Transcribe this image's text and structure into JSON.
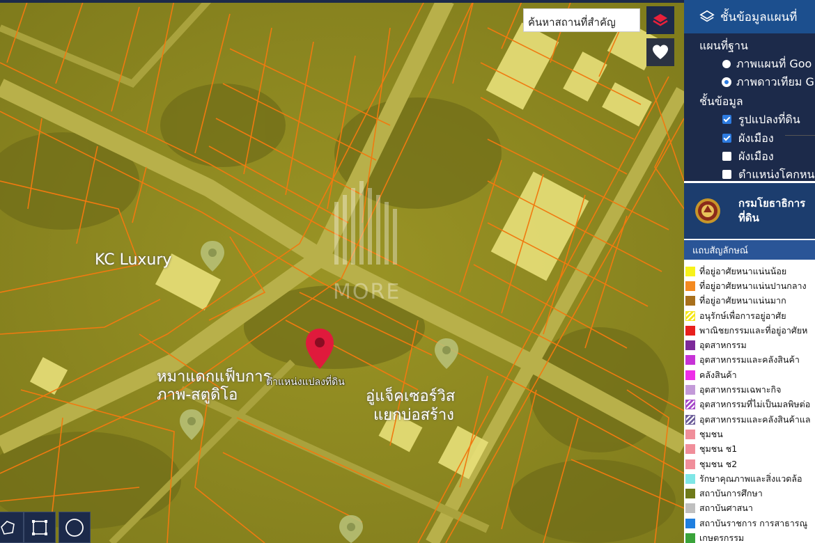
{
  "search": {
    "placeholder": "ค้นหาสถานที่สำคัญ"
  },
  "map": {
    "place_labels": [
      "KC Luxury",
      "หมาแดกแฟ็บการ",
      "ภาพ-สตูดิโอ",
      "อู่แจ็คเซอร์วิส",
      "แยกบ่อสร้าง"
    ],
    "marker_label": "ตำแหน่งแปลงที่ดิน",
    "watermark": "MORE"
  },
  "layers_panel": {
    "title": "ชั้นข้อมูลแผนที่",
    "basemap_heading": "แผนที่ฐาน",
    "basemaps": [
      {
        "label": "ภาพแผนที่ Goo",
        "selected": false
      },
      {
        "label": "ภาพดาวเทียม G",
        "selected": true
      }
    ],
    "layers_heading": "ชั้นข้อมูล",
    "layers": [
      {
        "label": "รูปแปลงที่ดิน",
        "checked": true
      },
      {
        "label": "ผังเมือง",
        "checked": true
      },
      {
        "label": "ผังเมือง",
        "checked": false
      },
      {
        "label": "ตำแหน่งโคกหน",
        "checked": false
      }
    ]
  },
  "department": {
    "line1": "กรมโยธาธิการ",
    "line2": "ที่ดิน"
  },
  "legend": {
    "title": "แถบสัญลักษณ์",
    "items": [
      {
        "label": "ที่อยู่อาศัยหนาแน่นน้อย",
        "color": "#f7f21b"
      },
      {
        "label": "ที่อยู่อาศัยหนาแน่นปานกลาง",
        "color": "#f48a20"
      },
      {
        "label": "ที่อยู่อาศัยหนาแน่นมาก",
        "color": "#a8701c"
      },
      {
        "label": "อนุรักษ์เพื่อการอยู่อาศัย",
        "color": "#f5e71a",
        "pattern": "hatch"
      },
      {
        "label": "พาณิชยกรรมและที่อยู่อาศัยห",
        "color": "#e8201d"
      },
      {
        "label": "อุตสาหกรรม",
        "color": "#7d2a9a"
      },
      {
        "label": "อุตสาหกรรมและคลังสินค้า",
        "color": "#c733d6"
      },
      {
        "label": "คลังสินค้า",
        "color": "#ee2ee8"
      },
      {
        "label": "อุตสาหกรรมเฉพาะกิจ",
        "color": "#c39ad8"
      },
      {
        "label": "อุตสาหกรรมที่ไม่เป็นมลพิษต่อ",
        "color": "#a64ac9",
        "pattern": "hatch"
      },
      {
        "label": "อุตสาหกรรมและคลังสินค้าแล",
        "color": "#6d5f9a",
        "pattern": "hatch"
      },
      {
        "label": "ชุมชน",
        "color": "#f08e9a"
      },
      {
        "label": "ชุมชน ช1",
        "color": "#f08e9a"
      },
      {
        "label": "ชุมชน ช2",
        "color": "#f08e9a"
      },
      {
        "label": "รักษาคุณภาพและสิ่งแวดล้อ",
        "color": "#7fe6e6"
      },
      {
        "label": "สถาบันการศึกษา",
        "color": "#6f7a1a"
      },
      {
        "label": "สถาบันศาสนา",
        "color": "#bfbfbf"
      },
      {
        "label": "สถาบันราชการ การสาธารณู",
        "color": "#1f7fe0"
      },
      {
        "label": "เกษตรกรรม",
        "color": "#3aa33a"
      }
    ]
  }
}
